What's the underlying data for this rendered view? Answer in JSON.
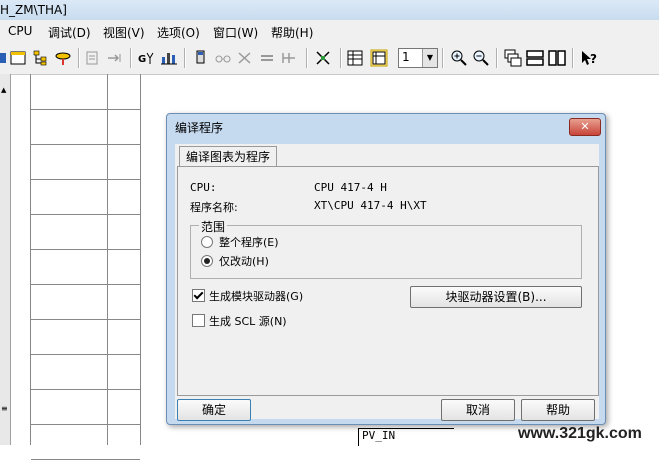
{
  "window": {
    "title_fragment": "H_ZM\\THA]"
  },
  "menu": {
    "items": [
      "CPU",
      "调试(D)",
      "视图(V)",
      "选项(O)",
      "窗口(W)",
      "帮助(H)"
    ]
  },
  "toolbar": {
    "zoom_value": "1",
    "icons": [
      "block-icon",
      "tree-icon",
      "link-icon",
      "sep",
      "stack-icon",
      "arrow-icon",
      "sep",
      "monitor-icon",
      "chart-icon",
      "sep",
      "download-icon",
      "glasses-icon",
      "edit-icon",
      "rows-icon",
      "compare-icon",
      "sep",
      "split-icon",
      "sep",
      "table-icon",
      "view-icon",
      "sep",
      "zoom-in-icon",
      "zoom-out-icon",
      "sep",
      "cascade-icon",
      "tile-h-icon",
      "tile-v-icon",
      "sep",
      "help-icon"
    ]
  },
  "dialog": {
    "title": "编译程序",
    "tab": "编译图表为程序",
    "cpu_label": "CPU:",
    "cpu_value": "CPU 417-4 H",
    "program_label": "程序名称:",
    "program_value": "XT\\CPU 417-4 H\\XT",
    "scope": {
      "title": "范围",
      "options": [
        "整个程序(E)",
        "仅改动(H)"
      ],
      "selected": 1
    },
    "checkboxes": [
      {
        "label": "生成模块驱动器(G)",
        "checked": true
      },
      {
        "label": "生成 SCL 源(N)",
        "checked": false
      }
    ],
    "driver_settings_button": "块驱动器设置(B)...",
    "ok_button": "确定",
    "cancel_button": "取消",
    "help_button": "帮助"
  },
  "background": {
    "pv_in_label": "PV_IN",
    "watermark": "www.321gk.com"
  },
  "colors": {
    "dialog_frame": "#c5d9ef",
    "close_button": "#c8453a"
  }
}
